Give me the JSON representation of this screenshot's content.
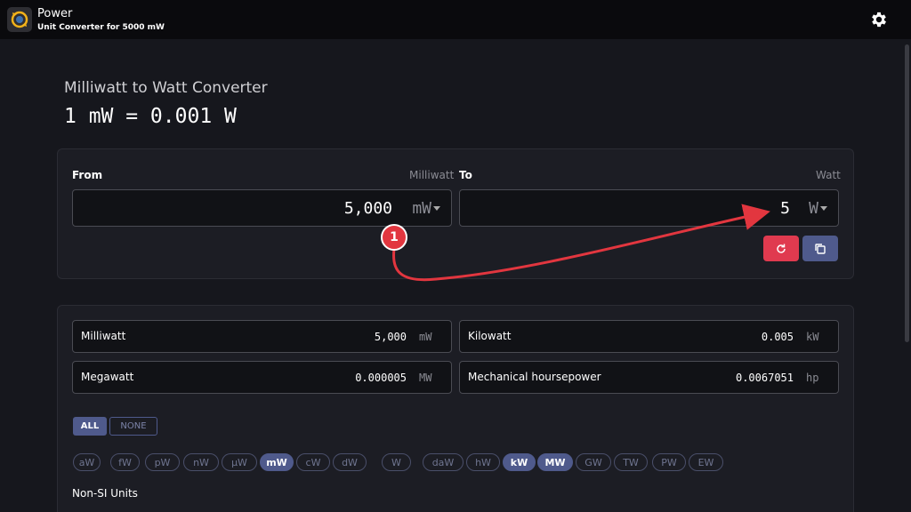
{
  "app": {
    "title": "Power",
    "subtitle": "Unit Converter for 5000 mW",
    "icon": "converter-logo-icon"
  },
  "converter": {
    "heading": "Milliwatt to Watt Converter",
    "equation": "1 mW = 0.001 W",
    "from": {
      "label": "From",
      "unit_name": "Milliwatt",
      "value": "5,000",
      "unit": "mW"
    },
    "to": {
      "label": "To",
      "unit_name": "Watt",
      "value": "5",
      "unit": "W"
    },
    "actions": {
      "reset_icon": "refresh-icon",
      "copy_icon": "copy-icon"
    }
  },
  "results": [
    {
      "name": "Milliwatt",
      "value": "5,000",
      "unit": "mW"
    },
    {
      "name": "Kilowatt",
      "value": "0.005",
      "unit": "kW"
    },
    {
      "name": "Megawatt",
      "value": "0.000005",
      "unit": "MW"
    },
    {
      "name": "Mechanical hoursepower",
      "value": "0.0067051",
      "unit": "hp"
    }
  ],
  "filters": {
    "all_label": "ALL",
    "none_label": "NONE",
    "chips": [
      {
        "label": "aW",
        "active": false
      },
      {
        "label": "fW",
        "active": false
      },
      {
        "label": "pW",
        "active": false
      },
      {
        "label": "nW",
        "active": false
      },
      {
        "label": "µW",
        "active": false
      },
      {
        "label": "mW",
        "active": true
      },
      {
        "label": "cW",
        "active": false
      },
      {
        "label": "dW",
        "active": false
      },
      {
        "label": "W",
        "active": false
      },
      {
        "label": "daW",
        "active": false
      },
      {
        "label": "hW",
        "active": false
      },
      {
        "label": "kW",
        "active": true
      },
      {
        "label": "MW",
        "active": true
      },
      {
        "label": "GW",
        "active": false
      },
      {
        "label": "TW",
        "active": false
      },
      {
        "label": "PW",
        "active": false
      },
      {
        "label": "EW",
        "active": false
      }
    ]
  },
  "sections": {
    "non_si": "Non-SI Units"
  },
  "annotation": {
    "badge": "1",
    "color": "#e2363f"
  },
  "colors": {
    "background": "#16171d",
    "accent": "#4f5a8c",
    "danger": "#e03a4f"
  }
}
